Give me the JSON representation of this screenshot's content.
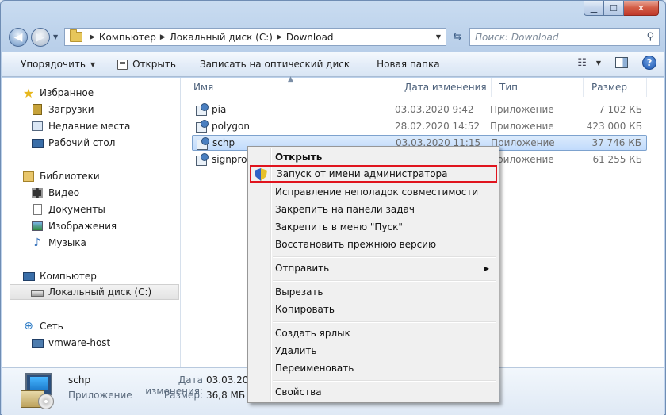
{
  "nav": {
    "breadcrumb": [
      "Компьютер",
      "Локальный диск (C:)",
      "Download"
    ],
    "search_placeholder": "Поиск: Download"
  },
  "toolbar": {
    "organize": "Упорядочить",
    "open": "Открыть",
    "burn": "Записать на оптический диск",
    "new_folder": "Новая папка"
  },
  "sidebar": {
    "favorites": "Избранное",
    "downloads": "Загрузки",
    "recent": "Недавние места",
    "desktop": "Рабочий стол",
    "libraries": "Библиотеки",
    "video": "Видео",
    "documents": "Документы",
    "pictures": "Изображения",
    "music": "Музыка",
    "computer": "Компьютер",
    "local_disk": "Локальный диск (C:)",
    "network": "Сеть",
    "host": "vmware-host"
  },
  "columns": {
    "name": "Имя",
    "date": "Дата изменения",
    "type": "Тип",
    "size": "Размер"
  },
  "files": [
    {
      "name": "pia",
      "date": "03.03.2020 9:42",
      "type": "Приложение",
      "size": "7 102 КБ"
    },
    {
      "name": "polygon",
      "date": "28.02.2020 14:52",
      "type": "Приложение",
      "size": "423 000 КБ"
    },
    {
      "name": "schp",
      "date": "03.03.2020 11:15",
      "type": "Приложение",
      "size": "37 746 КБ"
    },
    {
      "name": "signpro",
      "date": "",
      "type": "Приложение",
      "size": "61 255 КБ"
    }
  ],
  "context_menu": {
    "open": "Открыть",
    "run_as_admin": "Запуск от имени администратора",
    "troubleshoot": "Исправление неполадок совместимости",
    "pin_taskbar": "Закрепить на панели задач",
    "pin_start": "Закрепить в меню \"Пуск\"",
    "restore": "Восстановить прежнюю версию",
    "send_to": "Отправить",
    "cut": "Вырезать",
    "copy": "Копировать",
    "create_shortcut": "Создать ярлык",
    "delete": "Удалить",
    "rename": "Переименовать",
    "properties": "Свойства"
  },
  "details": {
    "name": "schp",
    "type": "Приложение",
    "date_label": "Дата изменения:",
    "date_value": "03.03.2020",
    "size_label": "Размер:",
    "size_value": "36,8 МБ"
  },
  "colors": {
    "highlight_frame": "#e0141e",
    "selection": "#c1dbfc"
  }
}
